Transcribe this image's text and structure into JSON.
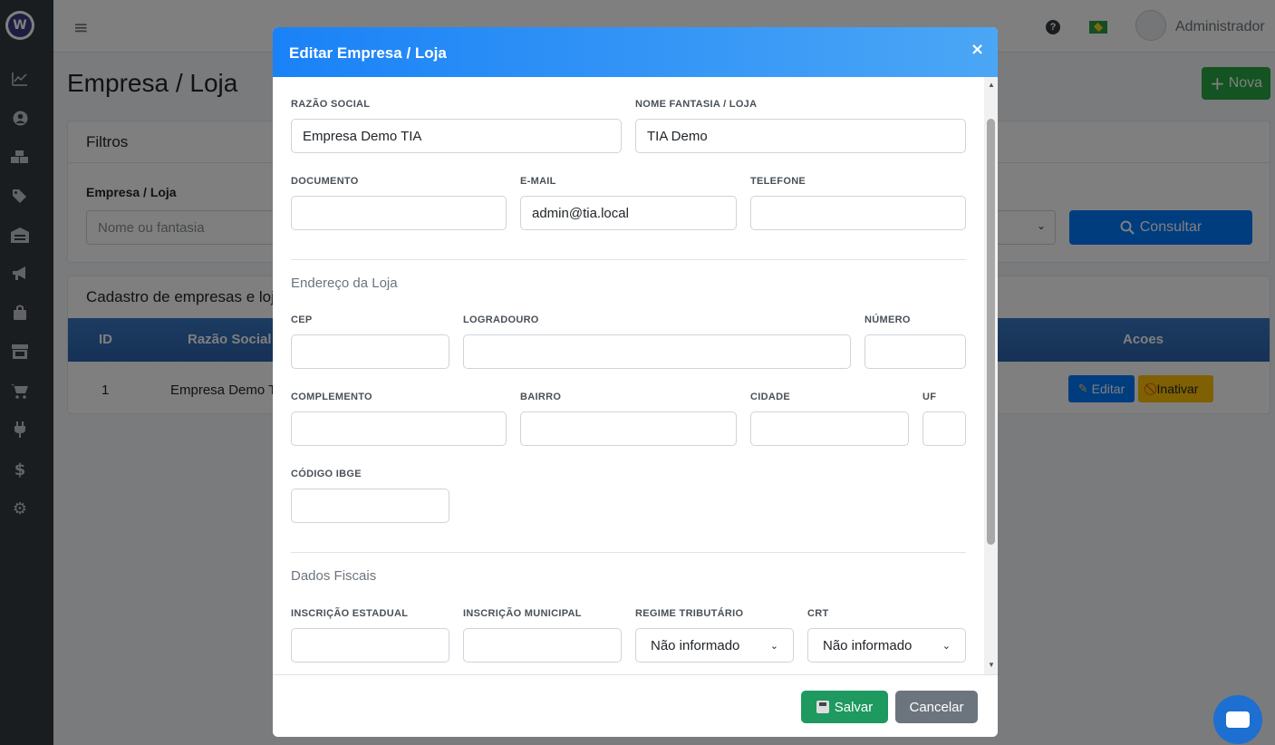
{
  "topbar": {
    "user_name": "Administrador",
    "help_glyph": "?"
  },
  "page": {
    "title": "Empresa / Loja",
    "new_button": "Nova",
    "filters": {
      "header": "Filtros",
      "label": "Empresa / Loja",
      "placeholder": "Nome ou fantasia",
      "search_button": "Consultar"
    },
    "listing": {
      "header": "Cadastro de empresas e loja",
      "columns": [
        "ID",
        "Razão Social",
        "Acoes"
      ],
      "rows": [
        {
          "id": "1",
          "razao_social": "Empresa Demo T"
        }
      ],
      "edit_button": "Editar",
      "deactivate_button": "Inativar"
    }
  },
  "modal": {
    "title": "Editar Empresa / Loja",
    "close_glyph": "×",
    "fields": {
      "razao_social": {
        "label": "RAZÃO SOCIAL",
        "value": "Empresa Demo TIA"
      },
      "nome_fantasia": {
        "label": "NOME FANTASIA / LOJA",
        "value": "TIA Demo"
      },
      "documento": {
        "label": "DOCUMENTO",
        "value": ""
      },
      "email": {
        "label": "E-MAIL",
        "value": "admin@tia.local"
      },
      "telefone": {
        "label": "TELEFONE",
        "value": ""
      },
      "cep": {
        "label": "CEP",
        "value": ""
      },
      "logradouro": {
        "label": "LOGRADOURO",
        "value": ""
      },
      "numero": {
        "label": "NÚMERO",
        "value": ""
      },
      "complemento": {
        "label": "COMPLEMENTO",
        "value": ""
      },
      "bairro": {
        "label": "BAIRRO",
        "value": ""
      },
      "cidade": {
        "label": "CIDADE",
        "value": ""
      },
      "uf": {
        "label": "UF",
        "value": ""
      },
      "codigo_ibge": {
        "label": "CÓDIGO IBGE",
        "value": ""
      },
      "inscricao_estadual": {
        "label": "INSCRIÇÃO ESTADUAL",
        "value": ""
      },
      "inscricao_municipal": {
        "label": "INSCRIÇÃO MUNICIPAL",
        "value": ""
      },
      "regime_tributario": {
        "label": "REGIME TRIBUTÁRIO",
        "value": "Não informado"
      },
      "crt": {
        "label": "CRT",
        "value": "Não informado"
      }
    },
    "sections": {
      "endereco": "Endereço da Loja",
      "fiscais": "Dados Fiscais"
    },
    "footer": {
      "save_button": "Salvar",
      "cancel_button": "Cancelar"
    }
  },
  "colors": {
    "accent_blue": "#007bff",
    "success_green": "#28a745",
    "save_green": "#1e9960",
    "warning_yellow": "#ffc107",
    "sidebar_bg": "#343a40"
  },
  "icons": [
    "logo-icon",
    "chart-icon",
    "user-icon",
    "boxes-icon",
    "tag-icon",
    "warehouse-icon",
    "megaphone-icon",
    "bag-icon",
    "store-icon",
    "cart-icon",
    "plug-icon",
    "dollar-icon",
    "gear-icon",
    "hamburger-icon",
    "help-icon",
    "brazil-flag-icon",
    "chat-icon",
    "save-icon",
    "search-icon",
    "pencil-icon",
    "ban-icon",
    "close-icon"
  ]
}
